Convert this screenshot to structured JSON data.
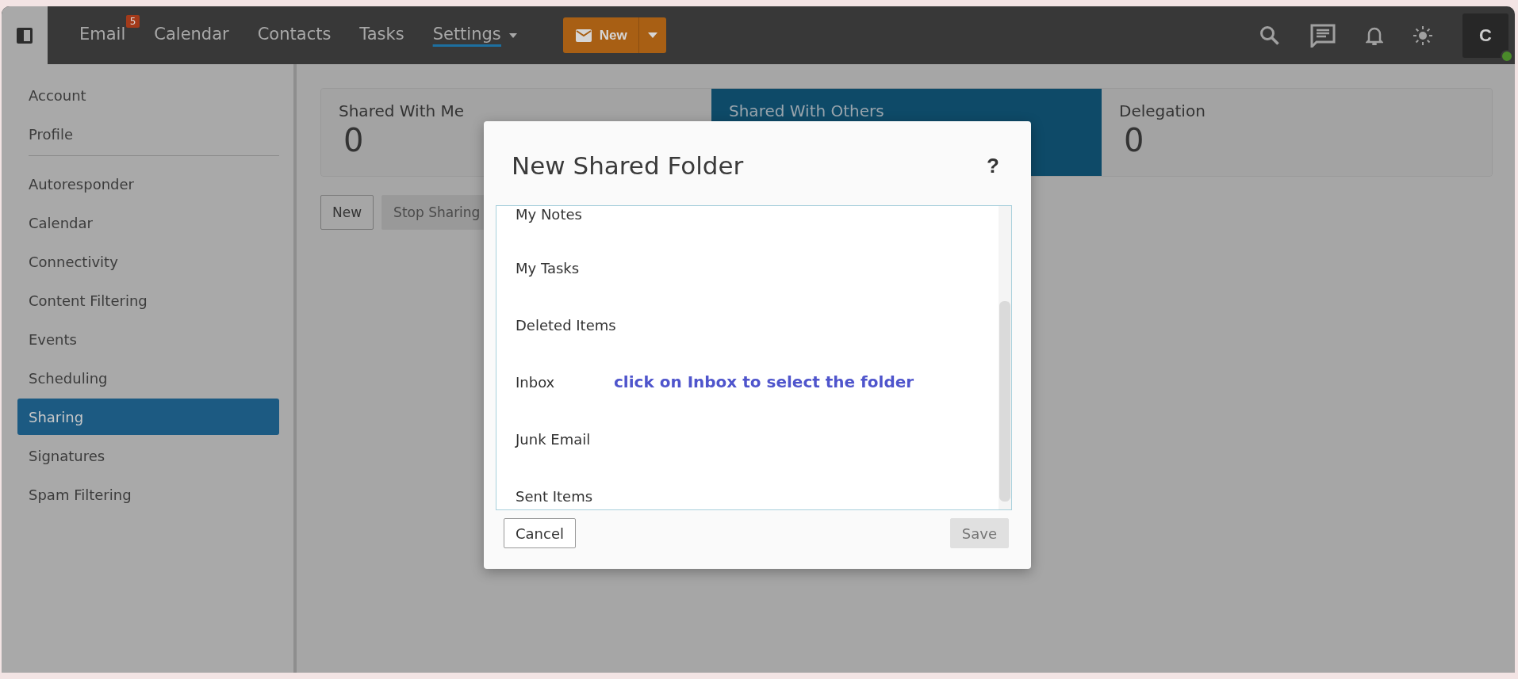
{
  "topbar": {
    "nav": [
      {
        "label": "Email",
        "badge": "5",
        "selected": false,
        "dropdown": false
      },
      {
        "label": "Calendar",
        "selected": false,
        "dropdown": false
      },
      {
        "label": "Contacts",
        "selected": false,
        "dropdown": false
      },
      {
        "label": "Tasks",
        "selected": false,
        "dropdown": false
      },
      {
        "label": "Settings",
        "selected": true,
        "dropdown": true
      }
    ],
    "new_button": "New",
    "avatar": "C"
  },
  "sidebar": {
    "groups": [
      [
        {
          "label": "Account",
          "selected": false
        },
        {
          "label": "Profile",
          "selected": false
        }
      ],
      [
        {
          "label": "Autoresponder",
          "selected": false
        },
        {
          "label": "Calendar",
          "selected": false
        },
        {
          "label": "Connectivity",
          "selected": false
        },
        {
          "label": "Content Filtering",
          "selected": false
        },
        {
          "label": "Events",
          "selected": false
        },
        {
          "label": "Scheduling",
          "selected": false
        },
        {
          "label": "Sharing",
          "selected": true
        },
        {
          "label": "Signatures",
          "selected": false
        },
        {
          "label": "Spam Filtering",
          "selected": false
        }
      ]
    ]
  },
  "cards": [
    {
      "title": "Shared With Me",
      "count": "0",
      "selected": false
    },
    {
      "title": "Shared With Others",
      "selected": true
    },
    {
      "title": "Delegation",
      "count": "0",
      "selected": false
    }
  ],
  "actions": [
    {
      "label": "New",
      "disabled": false
    },
    {
      "label": "Stop Sharing",
      "disabled": true
    }
  ],
  "dialog": {
    "title": "New Shared Folder",
    "help": "?",
    "folders": [
      "My Notes",
      "My Tasks",
      "Deleted Items",
      "Inbox",
      "Junk Email",
      "Sent Items"
    ],
    "annotation": "click on Inbox to select the folder",
    "buttons": [
      {
        "label": "Cancel",
        "disabled": false
      },
      {
        "label": "Save",
        "disabled": true
      }
    ]
  }
}
